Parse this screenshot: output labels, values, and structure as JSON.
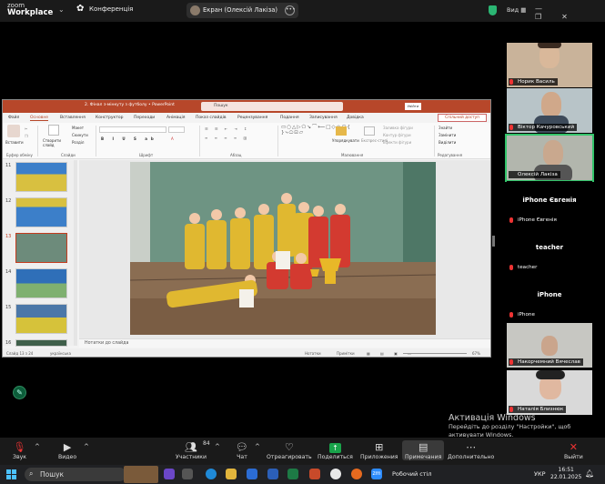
{
  "topbar": {
    "logo_line1": "zoom",
    "logo_line2": "Workplace",
    "conference_label": "Конференція",
    "share_label": "Екран (Олексій Лакіза)",
    "view_label": "Вид"
  },
  "ppt": {
    "doc_title": "2. Фінал з-мінкуту з футболу  •  PowerPoint",
    "search_placeholder": "Пошук",
    "signin_label": "Увійти",
    "menu": [
      "Файл",
      "Основне",
      "Вставлення",
      "Конструктор",
      "Переходи",
      "Анімація",
      "Показ слайдів",
      "Рецензування",
      "Подання",
      "Записування",
      "Довідка"
    ],
    "share_button": "Спільний доступ",
    "ribbon": {
      "paste": "Вставити",
      "new_slide": "Створити слайд",
      "layout": "Макет",
      "reset": "Скинути",
      "section": "Розділ",
      "arrange": "Упорядкувати",
      "quick_styles": "Експрес-стилі",
      "shape_fill": "Заливка фігури",
      "shape_outline": "Контур фігури",
      "shape_effects": "Ефекти фігури",
      "find": "Знайти",
      "replace": "Замінити",
      "select": "Виділити",
      "groups": {
        "clipboard": "Буфер обміну",
        "slides": "Слайди",
        "font": "Шрифт",
        "paragraph": "Абзац",
        "drawing": "Малювання",
        "editing": "Редагування"
      }
    },
    "thumbnails": [
      {
        "num": "11",
        "selected": false,
        "color": "#d8c040"
      },
      {
        "num": "12",
        "selected": false,
        "color": "#3c7fc9"
      },
      {
        "num": "13",
        "selected": true,
        "color": "#6d8b7b"
      },
      {
        "num": "14",
        "selected": false,
        "color": "#2f6fb8"
      },
      {
        "num": "15",
        "selected": false,
        "color": "#4b77a8"
      },
      {
        "num": "16",
        "selected": false,
        "color": "#3f5f4a"
      }
    ],
    "notes_placeholder": "Нотатки до слайда",
    "status": {
      "slide_info": "Слайд 13 з 24",
      "language": "українська",
      "notes_btn": "Нотатки",
      "comments_btn": "Примітки",
      "zoom": "67%"
    }
  },
  "participants": [
    {
      "name": "Норик Василь",
      "type": "video",
      "speaking": false
    },
    {
      "name": "Віктор Качуровський",
      "type": "video",
      "speaking": false
    },
    {
      "name": "Олексій Лакіза",
      "type": "video",
      "speaking": true
    },
    {
      "name": "iPhone Євгенія",
      "big": "iPhone Євгенія",
      "type": "name",
      "speaking": false
    },
    {
      "name": "teacher",
      "big": "teacher",
      "type": "name",
      "speaking": false
    },
    {
      "name": "iPhone",
      "big": "iPhone",
      "type": "name",
      "speaking": false
    },
    {
      "name": "Накорчемний Вячеслав",
      "type": "video",
      "speaking": false
    },
    {
      "name": "Наталія Близнюк",
      "type": "video",
      "speaking": false
    }
  ],
  "activation": {
    "title": "Активація Windows",
    "line1": "Перейдіть до розділу \"Настройки\", щоб",
    "line2": "активувати Windows."
  },
  "toolbar": {
    "audio": "Звук",
    "video": "Видео",
    "participants": "Участники",
    "participants_count": "84",
    "chat": "Чат",
    "react": "Отреагировать",
    "share": "Поделиться",
    "apps": "Приложения",
    "notes": "Примечания",
    "more": "Дополнительно",
    "leave": "Выйти"
  },
  "taskbar": {
    "search_placeholder": "Пошук",
    "desktop_label": "Робочий стіл",
    "keyboard": "УКР",
    "time": "16:51",
    "date": "22.01.2025"
  },
  "colors": {
    "ppt_accent": "#b7472a",
    "zoom_green": "#19a34a",
    "speaker_outline": "#33c36a"
  }
}
